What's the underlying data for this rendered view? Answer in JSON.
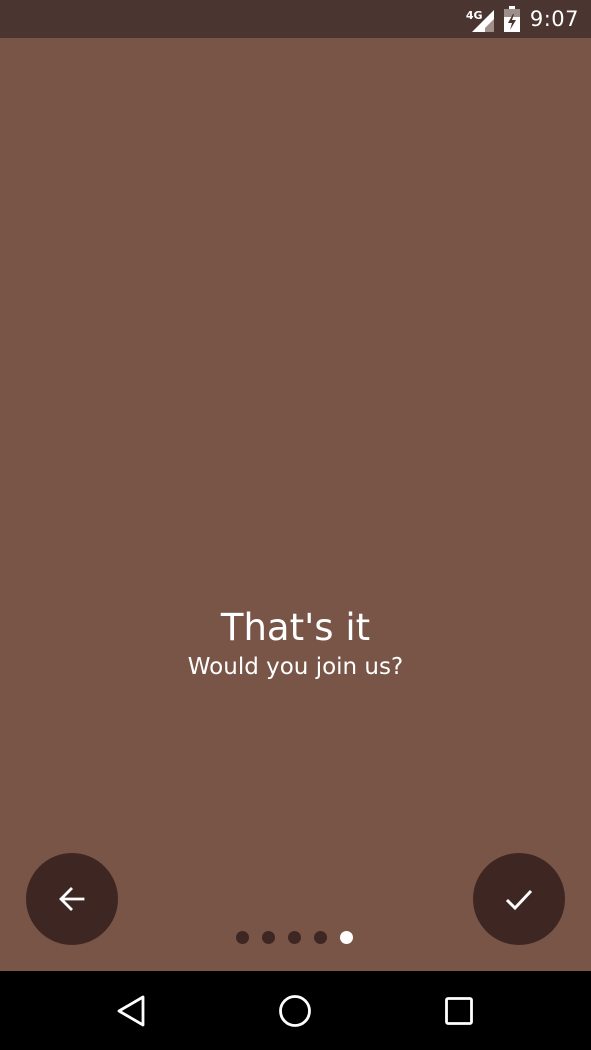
{
  "status_bar": {
    "network": "4G",
    "time": "9:07",
    "icons": [
      "signal-icon",
      "battery-icon"
    ],
    "background": "#4a3530"
  },
  "slide": {
    "title": "That's it",
    "subtitle": "Would you join us?",
    "background": "#795548"
  },
  "controls": {
    "back_icon": "arrow-left-icon",
    "done_icon": "check-icon",
    "fab_color": "#3e2723"
  },
  "pager": {
    "page_count": 5,
    "current_page": 5
  },
  "nav_bar": {
    "buttons": [
      "back-triangle-icon",
      "home-circle-icon",
      "recents-square-icon"
    ]
  }
}
